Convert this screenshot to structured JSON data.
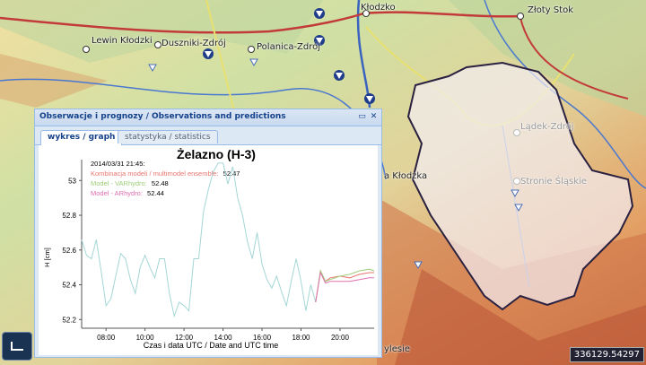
{
  "map": {
    "towns": [
      {
        "id": "klodzko",
        "name": "Kłodzko"
      },
      {
        "id": "zloty-stok",
        "name": "Złoty Stok"
      },
      {
        "id": "lewin",
        "name": "Lewin Kłodzki"
      },
      {
        "id": "duszniki",
        "name": "Duszniki-Zdrój"
      },
      {
        "id": "polanica",
        "name": "Polanica-Zdrój"
      },
      {
        "id": "ladek",
        "name": "Lądek-Zdrój"
      },
      {
        "id": "stronie",
        "name": "Stronie Śląskie"
      },
      {
        "id": "bystrzyca",
        "name": "a Kłodzka"
      },
      {
        "id": "slesie",
        "name": "ylesie"
      }
    ],
    "coordinates": "336129.54297"
  },
  "panel": {
    "title": "Obserwacje i prognozy / Observations and predictions",
    "tabs": [
      {
        "label": "wykres / graph",
        "active": true
      },
      {
        "label": "statystyka / statistics",
        "active": false
      }
    ]
  },
  "chart_data": {
    "type": "line",
    "title": "Żelazno (H-3)",
    "xlabel": "Czas i data UTC / Date and UTC time",
    "ylabel": "H [cm]",
    "ylim": [
      52.15,
      53.12
    ],
    "xlim": [
      6.75,
      21.75
    ],
    "xticks": [
      "08:00",
      "10:00",
      "12:00",
      "14:00",
      "16:00",
      "18:00",
      "20:00"
    ],
    "yticks": [
      "52.2",
      "52.4",
      "52.6",
      "52.8",
      "53"
    ],
    "info": {
      "timestamp": "2014/03/31 21:45:",
      "entries": [
        {
          "label": "Kombinacja modeli / multimodel ensemble:",
          "value": "52.47",
          "color": "#e8746f"
        },
        {
          "label": "Model - VARhydro:",
          "value": "52.48",
          "color": "#9fcf7a"
        },
        {
          "label": "Model - ARhydro:",
          "value": "52.44",
          "color": "#e070b0"
        }
      ]
    },
    "series": [
      {
        "color": "#a5d6d6",
        "x": [
          6.75,
          7.0,
          7.25,
          7.5,
          7.75,
          8.0,
          8.25,
          8.5,
          8.75,
          9.0,
          9.25,
          9.5,
          9.75,
          10.0,
          10.25,
          10.5,
          10.75,
          11.0,
          11.25,
          11.5,
          11.75,
          12.0,
          12.25,
          12.5,
          12.75,
          13.0,
          13.25,
          13.5,
          13.75,
          14.0,
          14.25,
          14.5,
          14.75,
          15.0,
          15.25,
          15.5,
          15.75,
          16.0,
          16.25,
          16.5,
          16.75,
          17.0,
          17.25,
          17.5,
          17.75,
          18.0,
          18.25,
          18.5,
          18.75
        ],
        "y": [
          52.66,
          52.57,
          52.55,
          52.66,
          52.48,
          52.28,
          52.32,
          52.45,
          52.58,
          52.55,
          52.43,
          52.35,
          52.5,
          52.57,
          52.5,
          52.44,
          52.55,
          52.55,
          52.35,
          52.22,
          52.3,
          52.28,
          52.25,
          52.55,
          52.55,
          52.82,
          52.95,
          53.05,
          53.1,
          53.1,
          52.98,
          53.08,
          52.9,
          52.8,
          52.65,
          52.55,
          52.7,
          52.52,
          52.43,
          52.38,
          52.45,
          52.36,
          52.28,
          52.42,
          52.55,
          52.42,
          52.25,
          52.4,
          52.3
        ]
      },
      {
        "name": "Kombinacja modeli / multimodel ensemble",
        "color": "#e8746f",
        "x": [
          18.75,
          19.0,
          19.25,
          19.5,
          20.0,
          20.5,
          21.0,
          21.5,
          21.75
        ],
        "y": [
          52.3,
          52.48,
          52.42,
          52.44,
          52.45,
          52.44,
          52.46,
          52.47,
          52.47
        ]
      },
      {
        "name": "Model - VARhydro",
        "color": "#9fcf7a",
        "x": [
          18.75,
          19.0,
          19.25,
          19.5,
          20.0,
          20.5,
          21.0,
          21.5,
          21.75
        ],
        "y": [
          52.3,
          52.48,
          52.42,
          52.43,
          52.45,
          52.46,
          52.48,
          52.49,
          52.48
        ]
      },
      {
        "name": "Model - ARhydro",
        "color": "#e070b0",
        "x": [
          18.75,
          19.0,
          19.25,
          19.5,
          20.0,
          20.5,
          21.0,
          21.5,
          21.75
        ],
        "y": [
          52.3,
          52.47,
          52.41,
          52.42,
          52.42,
          52.42,
          52.43,
          52.44,
          52.44
        ]
      }
    ]
  }
}
